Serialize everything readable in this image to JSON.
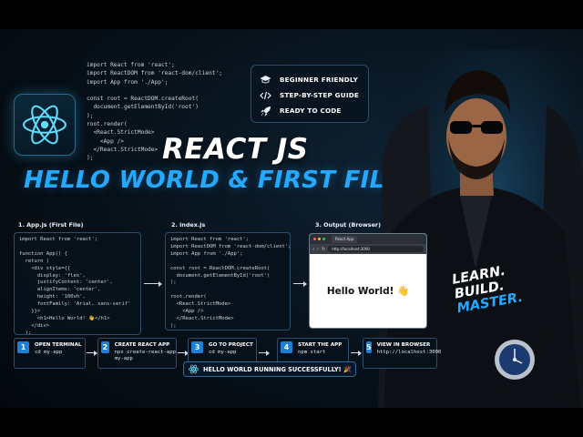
{
  "colors": {
    "accent": "#24a9ff",
    "background": "#071018",
    "react_blue": "#61dafb",
    "step_badge": "#1e7fd6"
  },
  "top_code": [
    "import React from 'react';",
    "import ReactDOM from 'react-dom/client';",
    "import App from './App';",
    "",
    "const root = ReactDOM.createRoot(",
    "  document.getElementById('root')",
    ");",
    "root.render(",
    "  <React.StrictMode>",
    "    <App />",
    "  </React.StrictMode>",
    ");"
  ],
  "features": [
    {
      "icon": "graduation-cap-icon",
      "label": "BEGINNER FRIENDLY"
    },
    {
      "icon": "code-icon",
      "label": "STEP-BY-STEP GUIDE"
    },
    {
      "icon": "rocket-icon",
      "label": "READY TO CODE"
    }
  ],
  "title_line1": "REACT JS",
  "title_line2": "HELLO WORLD & FIRST FILE",
  "panels": {
    "app": {
      "label": "1. App.js (First File)",
      "code": "import React from 'react';\n\nfunction App() {\n  return (\n    <div style={{\n      display: 'flex',\n      justifyContent: 'center',\n      alignItems: 'center',\n      height: '100vh',\n      fontFamily: 'Arial, sans-serif'\n    }}>\n      <h1>Hello World! 👋</h1>\n    </div>\n  );\n}\nexport default App;"
    },
    "index": {
      "label": "2. index.js",
      "code": "import React from 'react';\nimport ReactDOM from 'react-dom/client';\nimport App from './App';\n\nconst root = ReactDOM.createRoot(\n  document.getElementById('root')\n);\n\nroot.render(\n  <React.StrictMode>\n    <App />\n  </React.StrictMode>\n);"
    },
    "output": {
      "label": "3. Output (Browser)",
      "tab_title": "React App",
      "url": "http://localhost:3000",
      "hello": "Hello World! 👋"
    }
  },
  "learn_lines": [
    "LEARN.",
    "BUILD.",
    "MASTER."
  ],
  "steps": [
    {
      "num": "1",
      "title": "OPEN TERMINAL",
      "cmd": "cd my-app"
    },
    {
      "num": "2",
      "title": "CREATE REACT APP",
      "cmd": "npx create-react-app\nmy-app"
    },
    {
      "num": "3",
      "title": "GO TO PROJECT",
      "cmd": "cd my-app"
    },
    {
      "num": "4",
      "title": "START THE APP",
      "cmd": "npm start"
    },
    {
      "num": "5",
      "title": "VIEW IN BROWSER",
      "cmd": "http://localhost:3000"
    }
  ],
  "success_text": "HELLO WORLD RUNNING SUCCESSFULLY! 🎉"
}
